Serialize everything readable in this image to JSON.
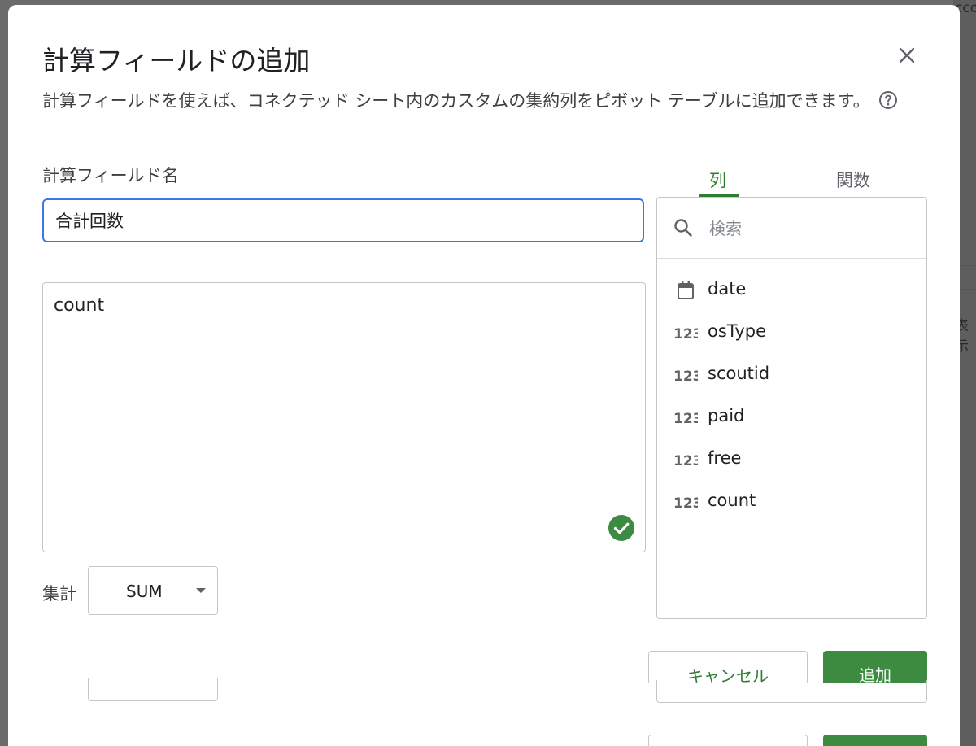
{
  "dialog": {
    "title": "計算フィールドの追加",
    "description": "計算フィールドを使えば、コネクテッド シート内のカスタムの集約列をピボット テーブルに追加できます。"
  },
  "background": {
    "partial_text_top": "cco",
    "partial_text_mid": "表示"
  },
  "form": {
    "name_label": "計算フィールド名",
    "name_value": "合計回数",
    "formula_value": "count",
    "aggregate_label": "集計",
    "aggregate_value": "SUM"
  },
  "panel": {
    "tabs": [
      {
        "label": "列",
        "active": true
      },
      {
        "label": "関数",
        "active": false
      }
    ],
    "search_placeholder": "検索",
    "columns": [
      {
        "label": "date",
        "icon": "calendar-icon"
      },
      {
        "label": "osType",
        "icon": "number-icon"
      },
      {
        "label": "scoutid",
        "icon": "number-icon"
      },
      {
        "label": "paid",
        "icon": "number-icon"
      },
      {
        "label": "free",
        "icon": "number-icon"
      },
      {
        "label": "count",
        "icon": "number-icon"
      }
    ]
  },
  "buttons": {
    "cancel": "キャンセル",
    "add": "追加"
  },
  "colors": {
    "accent_green": "#2e7d32",
    "primary_button": "#3d8b40",
    "input_focus_blue": "#3b78e7",
    "valid_check": "#3d8b40"
  }
}
